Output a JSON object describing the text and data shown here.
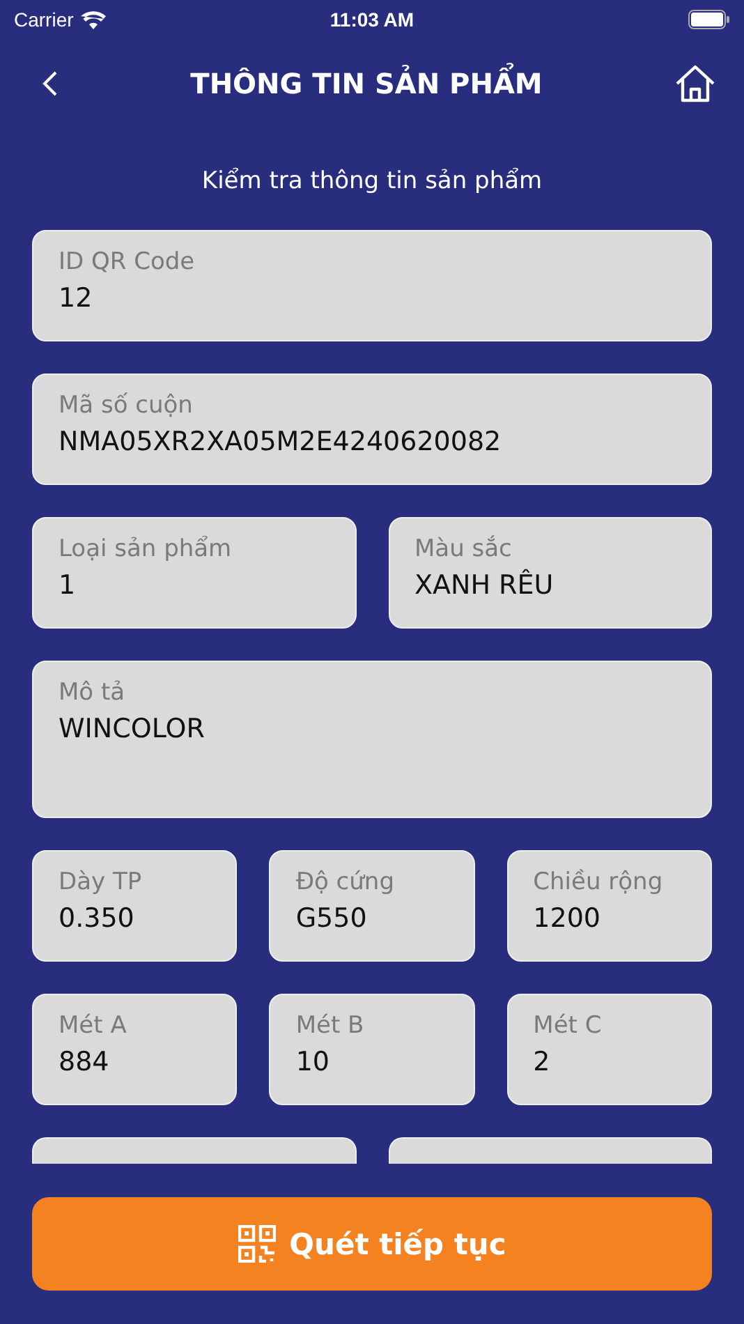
{
  "status_bar": {
    "carrier": "Carrier",
    "time": "11:03 AM"
  },
  "header": {
    "title": "THÔNG TIN SẢN PHẨM"
  },
  "subtitle": "Kiểm tra thông tin sản phẩm",
  "rows": [
    {
      "fields": [
        {
          "kind": "input",
          "label": "ID QR Code",
          "value": "12"
        }
      ]
    },
    {
      "fields": [
        {
          "kind": "input",
          "label": "Mã số cuộn",
          "value": "NMA05XR2XA05M2E4240620082"
        }
      ]
    },
    {
      "fields": [
        {
          "kind": "input",
          "label": "Loại sản phẩm",
          "value": "1"
        },
        {
          "kind": "input",
          "label": "Màu sắc",
          "value": "XANH RÊU"
        }
      ]
    },
    {
      "fields": [
        {
          "kind": "textarea",
          "label": "Mô tả",
          "value": "WINCOLOR"
        }
      ]
    },
    {
      "fields": [
        {
          "kind": "input",
          "label": "Dày TP",
          "value": "0.350"
        },
        {
          "kind": "input",
          "label": "Độ cứng",
          "value": "G550"
        },
        {
          "kind": "input",
          "label": "Chiều rộng",
          "value": "1200"
        }
      ]
    },
    {
      "fields": [
        {
          "kind": "input",
          "label": "Mét A",
          "value": "884"
        },
        {
          "kind": "input",
          "label": "Mét B",
          "value": "10"
        },
        {
          "kind": "input",
          "label": "Mét C",
          "value": "2"
        }
      ]
    },
    {
      "fields": [
        {
          "kind": "clipped"
        },
        {
          "kind": "clipped"
        }
      ]
    }
  ],
  "scan_button": {
    "label": "Quét tiếp tục"
  }
}
